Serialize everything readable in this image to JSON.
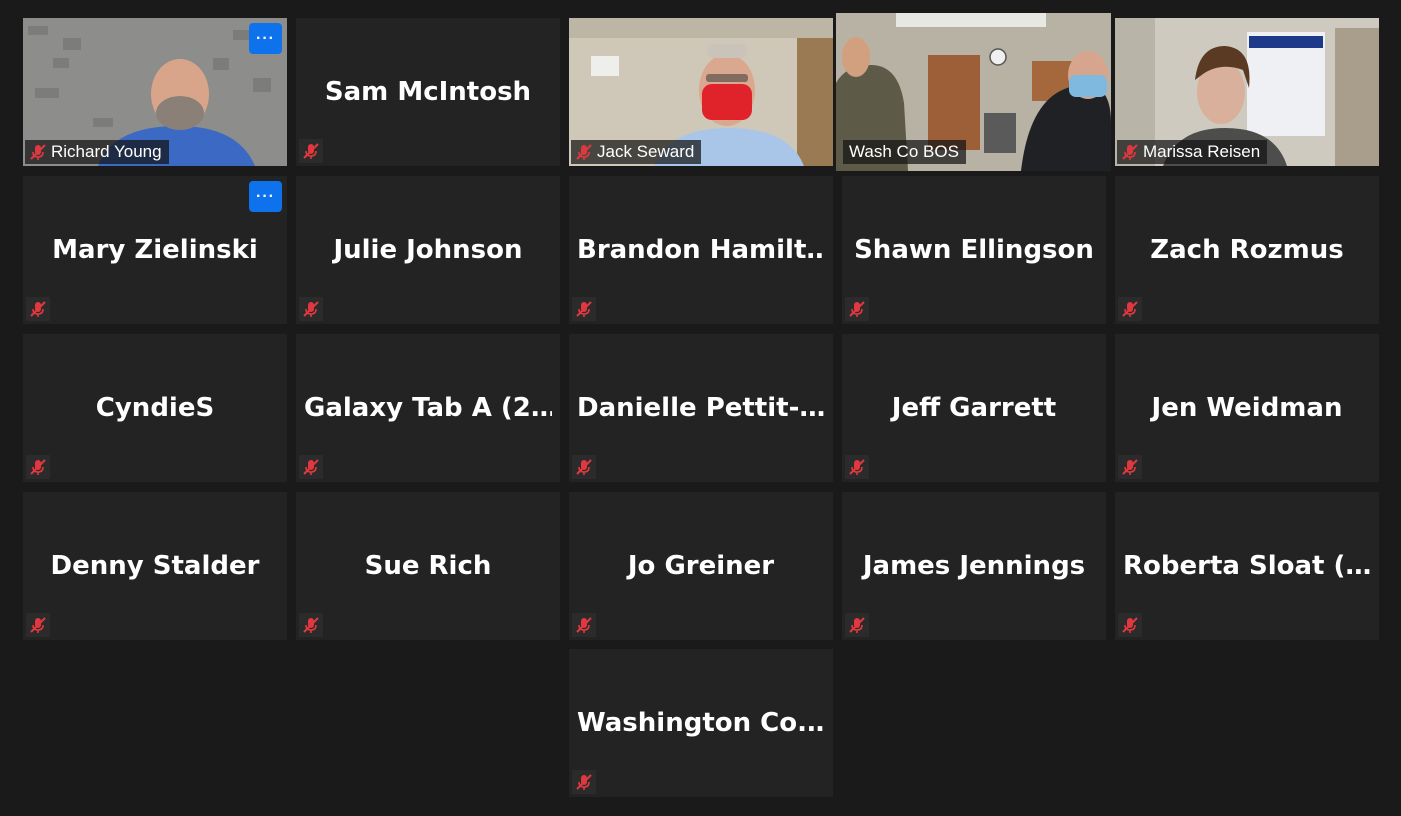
{
  "participants": [
    {
      "name": "Richard Young",
      "video": true
    },
    {
      "name": "Sam McIntosh",
      "video": false
    },
    {
      "name": "Jack Seward",
      "video": true
    },
    {
      "name": "Wash Co BOS",
      "video": true,
      "active_speaker": true
    },
    {
      "name": "Marissa Reisen",
      "video": true
    },
    {
      "name": "Mary Zielinski",
      "video": false
    },
    {
      "name": "Julie Johnson",
      "video": false
    },
    {
      "name": "Brandon  Hamilt…",
      "video": false
    },
    {
      "name": "Shawn Ellingson",
      "video": false
    },
    {
      "name": "Zach Rozmus",
      "video": false
    },
    {
      "name": "CyndieS",
      "video": false
    },
    {
      "name": "Galaxy  Tab  A  (2…",
      "video": false
    },
    {
      "name": "Danielle  Pettit-…",
      "video": false
    },
    {
      "name": "Jeff Garrett",
      "video": false
    },
    {
      "name": "Jen Weidman",
      "video": false
    },
    {
      "name": "Denny Stalder",
      "video": false
    },
    {
      "name": "Sue Rich",
      "video": false
    },
    {
      "name": "Jo Greiner",
      "video": false
    },
    {
      "name": "James Jennings",
      "video": false
    },
    {
      "name": "Roberta  Sloat    (…",
      "video": false
    },
    {
      "name": "Washington  Co.…",
      "video": false
    }
  ],
  "more_button": {
    "label": "···"
  },
  "icons": {
    "mute": "mic-muted-icon",
    "more": "more-options-icon"
  },
  "colors": {
    "background": "#1a1a1a",
    "tile": "#232323",
    "active_border": "#e3ec7a",
    "mute": "#e0383e",
    "more_button": "#0e72ed"
  }
}
